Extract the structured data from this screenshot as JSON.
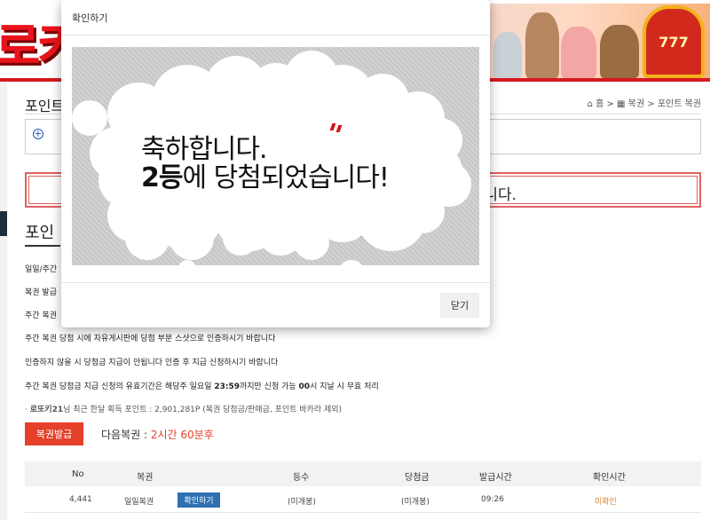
{
  "banner": {
    "logo_text": "로키",
    "slot_text": "777"
  },
  "section": {
    "title": "포인트",
    "breadcrumb": "⌂ 홈 > ▦ 복권 > 포인트 복권"
  },
  "alert": {
    "text": "니다."
  },
  "sub_title": "포인",
  "rules": {
    "r1": "일일/주간",
    "r2": "복권 발급",
    "r3": "주간 복권",
    "r4": "주간 복권 당첨 시에 자유게시판에 당첨 부분 스샷으로 인증하시기 바랍니다",
    "r5": "인증하지 않을 시 당첨금 지급이 안됩니다 인증 후 지급 신청하시기 바랍니다",
    "r6_prefix": "주간 복권 당첨금 지급 신청의 유효기간은 해당주 일요일 ",
    "r6_time1": "23:59",
    "r6_mid": "까지만 신청 가능 ",
    "r6_time2": "00",
    "r6_suffix": "시 지날 시 무효 처리",
    "r7_prefix": "· ",
    "r7_site": "로또키21",
    "r7_rest": "님 최근 한달 획득 포인트 : 2,901,281P (복권 당첨금/판매금, 포인트 바카라 제외)"
  },
  "issue_button": "복권발급",
  "next_lottery": {
    "label": "다음복권 : ",
    "time": "2시간 60분후"
  },
  "table": {
    "headers": [
      "No",
      "복권",
      "등수",
      "당첨금",
      "발급시간",
      "확인시간"
    ],
    "row": {
      "no": "4,441",
      "type": "일일복권",
      "confirm_button": "확인하기",
      "rank": "(미개봉)",
      "prize": "(미개봉)",
      "issued": "09:26",
      "checked": "미확인"
    }
  },
  "modal": {
    "title": "확인하기",
    "line1": "축하합니다.",
    "line2_bold": "2등",
    "line2_rest": "에 당첨되었습니다!",
    "close_button": "닫기"
  }
}
